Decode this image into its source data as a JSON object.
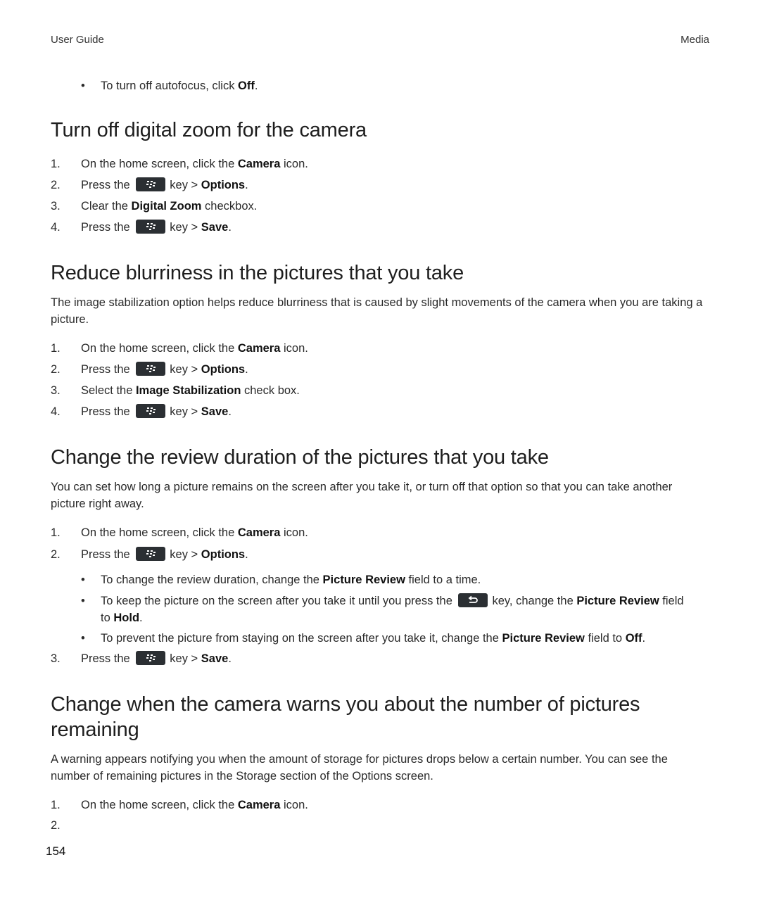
{
  "header": {
    "left": "User Guide",
    "right": "Media"
  },
  "top_bullet": {
    "pre": "To turn off autofocus, click ",
    "bold": "Off",
    "post": "."
  },
  "sections": [
    {
      "title": "Turn off digital zoom for the camera",
      "steps": [
        {
          "num": "1.",
          "pre": "On the home screen, click the ",
          "bold": "Camera",
          "post": " icon."
        },
        {
          "num": "2.",
          "pre": "Press the ",
          "key": "menu-key",
          "mid": "key > ",
          "bold": "Options",
          "post": "."
        },
        {
          "num": "3.",
          "pre": "Clear the ",
          "bold": "Digital Zoom",
          "post": " checkbox."
        },
        {
          "num": "4.",
          "pre": "Press the ",
          "key": "menu-key",
          "mid": "key > ",
          "bold": "Save",
          "post": "."
        }
      ]
    },
    {
      "title": "Reduce blurriness in the pictures that you take",
      "intro": "The image stabilization option helps reduce blurriness that is caused by slight movements of the camera when you are taking a picture.",
      "steps": [
        {
          "num": "1.",
          "pre": "On the home screen, click the ",
          "bold": "Camera",
          "post": " icon."
        },
        {
          "num": "2.",
          "pre": "Press the ",
          "key": "menu-key",
          "mid": "key > ",
          "bold": "Options",
          "post": "."
        },
        {
          "num": "3.",
          "pre": "Select the ",
          "bold": "Image Stabilization",
          "post": " check box."
        },
        {
          "num": "4.",
          "pre": "Press the ",
          "key": "menu-key",
          "mid": "key > ",
          "bold": "Save",
          "post": "."
        }
      ]
    },
    {
      "title": "Change the review duration of the pictures that you take",
      "intro": "You can set how long a picture remains on the screen after you take it, or turn off that option so that you can take another picture right away.",
      "steps": [
        {
          "num": "1.",
          "pre": "On the home screen, click the ",
          "bold": "Camera",
          "post": " icon."
        },
        {
          "num": "2.",
          "pre": "Press the ",
          "key": "menu-key",
          "mid": "key > ",
          "bold": "Options",
          "post": "."
        },
        {
          "num": "3.",
          "pre": "Press the ",
          "key": "menu-key",
          "mid": "key > ",
          "bold": "Save",
          "post": "."
        }
      ],
      "bullets": [
        {
          "pre": "To change the review duration, change the ",
          "bold": "Picture Review",
          "post": " field to a time."
        },
        {
          "pre": "To keep the picture on the screen after you take it until you press the ",
          "key": "escape-key",
          "mid": "key, change the ",
          "bold": "Picture Review",
          "post": " field",
          "line2_pre": "to ",
          "line2_bold": "Hold",
          "line2_post": "."
        },
        {
          "pre": "To prevent the picture from staying on the screen after you take it, change the ",
          "bold": "Picture Review",
          "post": " field to ",
          "bold2": "Off",
          "post2": "."
        }
      ]
    },
    {
      "title_line1": "Change when the camera warns you about the number of pictures",
      "title_line2": "remaining",
      "intro": "A warning appears notifying you when the amount of storage for pictures drops below a certain number. You can see the number of remaining pictures in the Storage section of the Options screen.",
      "steps": [
        {
          "num": "1.",
          "pre": "On the home screen, click the ",
          "bold": "Camera",
          "post": " icon."
        },
        {
          "num": "2.",
          "pre": ""
        }
      ]
    }
  ],
  "page_number": "154"
}
